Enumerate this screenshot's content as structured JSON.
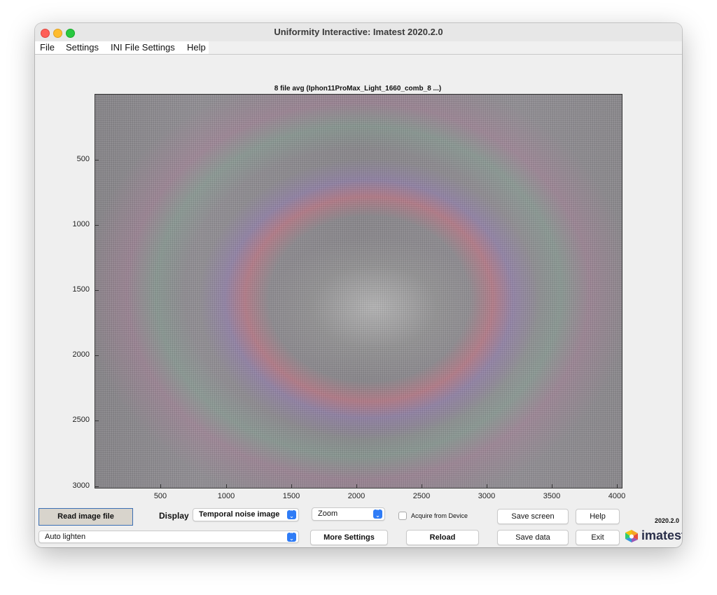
{
  "window": {
    "title": "Uniformity Interactive:  Imatest 2020.2.0"
  },
  "menu": [
    "File",
    "Settings",
    "INI File Settings",
    "Help"
  ],
  "plot": {
    "title": "8 file avg  (Iphon11ProMax_Light_1660_comb_8 ...)",
    "y_ticks": [
      "500",
      "1000",
      "1500",
      "2000",
      "2500",
      "3000"
    ],
    "x_ticks": [
      "500",
      "1000",
      "1500",
      "2000",
      "2500",
      "3000",
      "3500",
      "4000"
    ]
  },
  "controls": {
    "read_image_file": "Read image file",
    "display_label": "Display",
    "display_select": "Temporal noise image",
    "zoom_select": "Zoom",
    "acquire_label": "Acquire from Device",
    "save_screen": "Save screen",
    "help": "Help",
    "version": "2020.2.0",
    "auto_lighten_select": "Auto lighten",
    "more_settings": "More Settings",
    "reload": "Reload",
    "save_data": "Save data",
    "exit": "Exit",
    "logo_text": "imatest"
  },
  "colors": {
    "accent": "#2f7cf6",
    "close": "#fe5f57",
    "minimize": "#febc2e",
    "maximize": "#28c840"
  }
}
